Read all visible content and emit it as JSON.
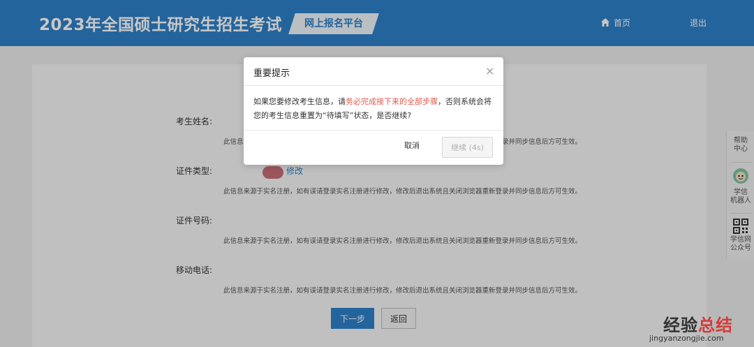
{
  "header": {
    "title": "2023年全国硕士研究生招生考试",
    "platform_tag": "网上报名平台",
    "home_label": "首页",
    "logout_label": "退出"
  },
  "form": {
    "fields": [
      {
        "label": "考生姓名:",
        "note": "此信息来源于实名注册，如有误请登录实名注册进行修改，修改后退出系统且关闭浏览器重新登录并同步信息后方可生效。"
      },
      {
        "label": "证件类型:",
        "note": "此信息来源于实名注册，如有误请登录实名注册进行修改，修改后退出系统且关闭浏览器重新登录并同步信息后方可生效。"
      },
      {
        "label": "证件号码:",
        "note": "此信息来源于实名注册，如有误请登录实名注册进行修改，修改后退出系统且关闭浏览器重新登录并同步信息后方可生效。"
      },
      {
        "label": "移动电话:",
        "note": "此信息来源于实名注册，如有误请登录实名注册进行修改，修改后退出系统且关闭浏览器重新登录并同步信息后方可生效。"
      }
    ],
    "edit_link": "修改",
    "next_button": "下一步",
    "back_button": "返回"
  },
  "sidebar": {
    "help_line1": "帮助",
    "help_line2": "中心",
    "robot_line1": "学信",
    "robot_line2": "机器人",
    "wechat_line1": "学信网",
    "wechat_line2": "公众号"
  },
  "modal": {
    "title": "重要提示",
    "close_icon": "×",
    "body_prefix": "如果您要修改考生信息，请",
    "body_highlight": "务必完成接下来的全部步骤",
    "body_suffix": "，否则系统会将您的考生信息重置为“待填写”状态，是否继续?",
    "cancel_label": "取消",
    "continue_label": "继续 (4s)"
  },
  "watermark": {
    "main_prefix": "经验",
    "main_highlight": "总结",
    "sub": "jingyanzongjie.com"
  },
  "colors": {
    "header_blue": "#2f80c8",
    "warning_red": "#e05a4f",
    "watermark_red": "#d73a3a"
  },
  "icons": [
    "home-icon",
    "close-icon",
    "robot-icon",
    "qr-code-icon"
  ]
}
